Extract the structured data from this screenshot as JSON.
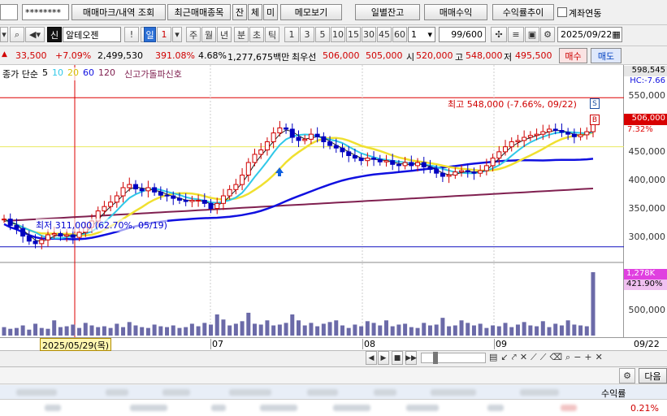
{
  "toolbar1": {
    "password": "********",
    "mark_button": "매매마크/내역 조회",
    "recent_button": "최근매매종목",
    "balance_tab": "잔",
    "exec_tab": "체",
    "unexec_tab": "미",
    "memo_button": "메모보기",
    "daily_balance_button": "일별잔고",
    "trade_profit_button": "매매수익",
    "profit_trend_button": "수익률추이",
    "account_link_label": "계좌연동"
  },
  "toolbar2": {
    "credit_badge": "신",
    "stock_name": "알테오젠",
    "period_day": "일",
    "period_day_value": "1",
    "periods": [
      "주",
      "월",
      "년",
      "분",
      "초",
      "틱"
    ],
    "minutes": [
      "1",
      "3",
      "5",
      "10",
      "15",
      "30",
      "45",
      "60"
    ],
    "minute_select": "1",
    "count": "99",
    "count_total": "/600",
    "date": "2025/09/22"
  },
  "quote": {
    "price": "33,500",
    "change_pct": "+7.09%",
    "volume": "2,499,530",
    "volume_ratio": "391.08%",
    "turnover": "4.68%",
    "amount": "1,277,675백만",
    "best_label": "최우선",
    "ask": "506,000",
    "bid": "505,000",
    "open_label": "시",
    "open": "520,000",
    "high_label": "고",
    "high": "548,000",
    "low_label": "저",
    "low": "495,500",
    "buy_button": "매수",
    "sell_button": "매도"
  },
  "chart_legend": {
    "close_label": "종가 단순",
    "ma": [
      "5",
      "10",
      "20",
      "60",
      "120"
    ],
    "signal": "신고가돌파신호"
  },
  "price_axis": {
    "top_value": "598,545",
    "hc_label": "HC:-7.66",
    "ticks": [
      "550,000",
      "500,000",
      "450,000",
      "400,000",
      "350,000",
      "300,000"
    ],
    "current_price_tag": "506,000",
    "current_pct_tag": "7.32%",
    "high_annotation": "최고 548,000 (-7.66%, 09/22)",
    "low_annotation": "최저 311,000 (62.70%, 05/19)",
    "marker_s": "S",
    "marker_b": "B"
  },
  "volume_axis": {
    "volume_tag": "1,278K",
    "ratio_tag": "421.90%",
    "tick": "500,000"
  },
  "date_axis": {
    "cursor_date": "2025/05/29(목)",
    "months": [
      "07",
      "08",
      "09"
    ],
    "last_date": "09/22"
  },
  "bottom": {
    "next_button": "다음",
    "profit_rate_label": "수익률",
    "profit_rate_value": "0.21%"
  },
  "chart_data": {
    "type": "candlestick",
    "ylim": [
      290000,
      600000
    ],
    "x_labels": [
      "07",
      "08",
      "09"
    ],
    "close": [
      355000,
      345000,
      340000,
      328000,
      320000,
      316000,
      322000,
      330000,
      332000,
      328000,
      330000,
      326000,
      334000,
      342000,
      352000,
      368000,
      375000,
      382000,
      392000,
      405000,
      410000,
      403000,
      400000,
      405000,
      398000,
      393000,
      392000,
      388000,
      385000,
      383000,
      385000,
      385000,
      380000,
      372000,
      380000,
      392000,
      402000,
      410000,
      425000,
      445000,
      458000,
      465000,
      478000,
      492000,
      500000,
      498000,
      485000,
      480000,
      482000,
      490000,
      486000,
      478000,
      472000,
      468000,
      462000,
      456000,
      452000,
      448000,
      452000,
      450000,
      446000,
      448000,
      442000,
      440000,
      445000,
      440000,
      445000,
      438000,
      434000,
      428000,
      423000,
      425000,
      430000,
      432000,
      430000,
      428000,
      432000,
      440000,
      452000,
      462000,
      470000,
      478000,
      480000,
      485000,
      488000,
      490000,
      494000,
      498000,
      496000,
      493000,
      490000,
      486000,
      489000,
      494000,
      506000
    ],
    "ma_lines": [
      {
        "name": "5",
        "color": "#222222",
        "values_note": "short"
      },
      {
        "name": "10",
        "color": "#30c8e8"
      },
      {
        "name": "20",
        "color": "#f0e030"
      },
      {
        "name": "60",
        "color": "#1010e0"
      },
      {
        "name": "120",
        "color": "#802050"
      }
    ],
    "volume": [
      10,
      8,
      9,
      12,
      7,
      14,
      9,
      8,
      18,
      10,
      11,
      13,
      9,
      15,
      12,
      10,
      11,
      9,
      14,
      10,
      16,
      12,
      10,
      9,
      13,
      11,
      10,
      12,
      9,
      10,
      14,
      11,
      15,
      13,
      25,
      19,
      12,
      14,
      17,
      27,
      14,
      13,
      18,
      12,
      13,
      15,
      25,
      18,
      12,
      15,
      11,
      14,
      16,
      18,
      12,
      9,
      13,
      11,
      17,
      15,
      12,
      18,
      11,
      13,
      14,
      10,
      9,
      15,
      12,
      13,
      21,
      11,
      12,
      18,
      15,
      12,
      14,
      9,
      12,
      11,
      15,
      10,
      13,
      16,
      12,
      11,
      17,
      10,
      14,
      12,
      18,
      13,
      12,
      11,
      75
    ]
  }
}
